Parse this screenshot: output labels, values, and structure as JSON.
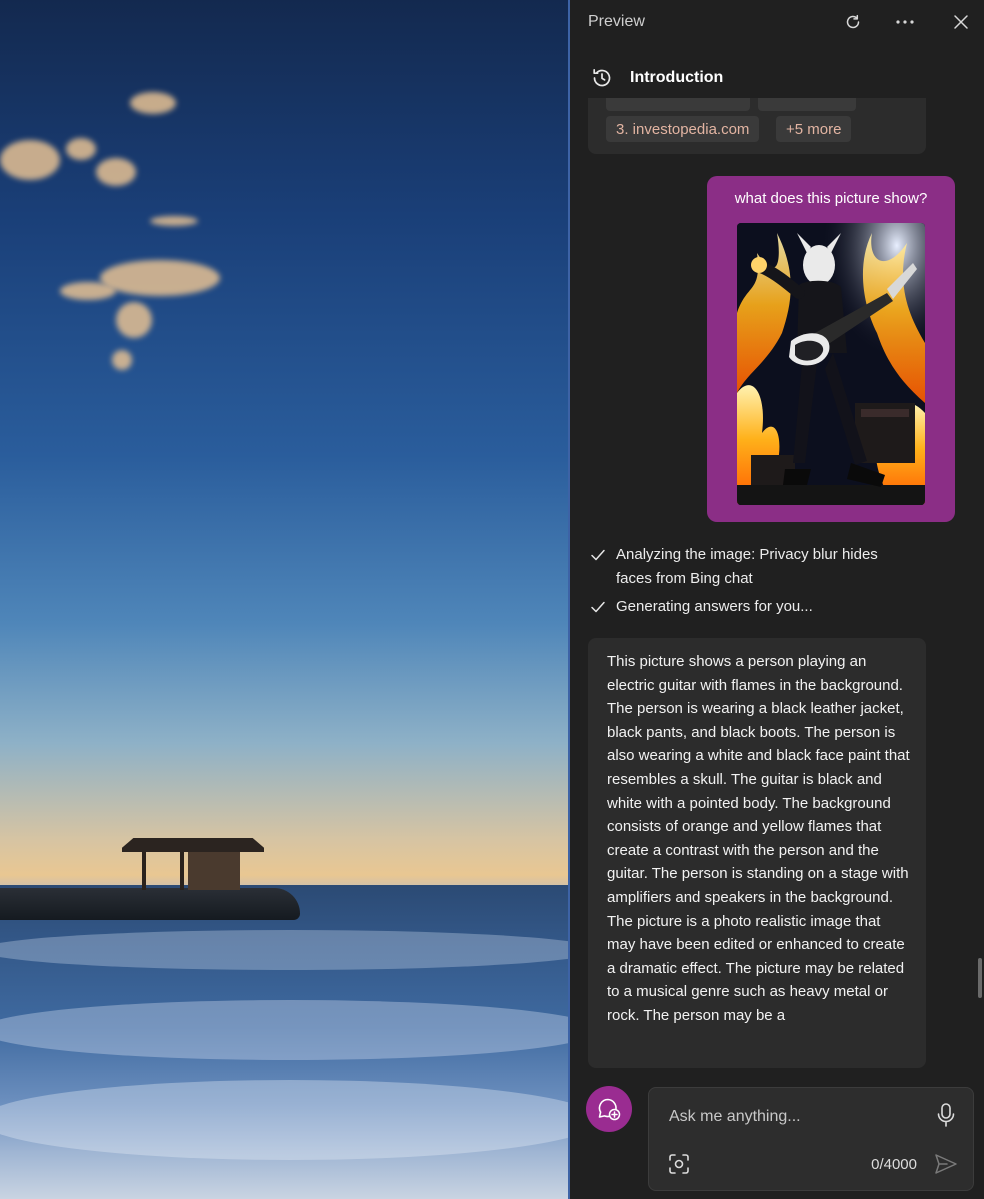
{
  "pane": {
    "title": "Preview",
    "header_icons": [
      "refresh-icon",
      "more-icon",
      "close-icon"
    ]
  },
  "chat": {
    "title": "Introduction",
    "history_icon": "history-icon"
  },
  "sources": {
    "chips": [
      "3. investopedia.com",
      "+5 more"
    ]
  },
  "user_message": {
    "text": "what does this picture show?",
    "image": "guitarist-in-flames-image"
  },
  "status": [
    {
      "icon": "check-icon",
      "text": "Analyzing the image: Privacy blur hides faces from Bing chat"
    },
    {
      "icon": "check-icon",
      "text": "Generating answers for you..."
    }
  ],
  "answer": {
    "text": "This picture shows a person playing an electric guitar with flames in the background. The person is wearing a black leather jacket, black pants, and black boots. The person is also wearing a white and black face paint that resembles a skull. The guitar is black and white with a pointed body. The background consists of orange and yellow flames that create a contrast with the person and the guitar. The person is standing on a stage with amplifiers and speakers in the background. The picture is a photo realistic image that may have been edited or enhanced to create a dramatic effect. The picture may be related to a musical genre such as heavy metal or rock. The person may be a"
  },
  "composer": {
    "placeholder": "Ask me anything...",
    "counter": "0/4000",
    "new_topic_icon": "new-topic-icon",
    "mic_icon": "microphone-icon",
    "image_icon": "image-capture-icon",
    "send_icon": "send-icon"
  },
  "colors": {
    "pane_bg": "#202020",
    "card_bg": "#2c2c2c",
    "user_bubble": "#8b2e86",
    "accent": "#9a2c91",
    "chip_text": "#e2b4a2"
  }
}
